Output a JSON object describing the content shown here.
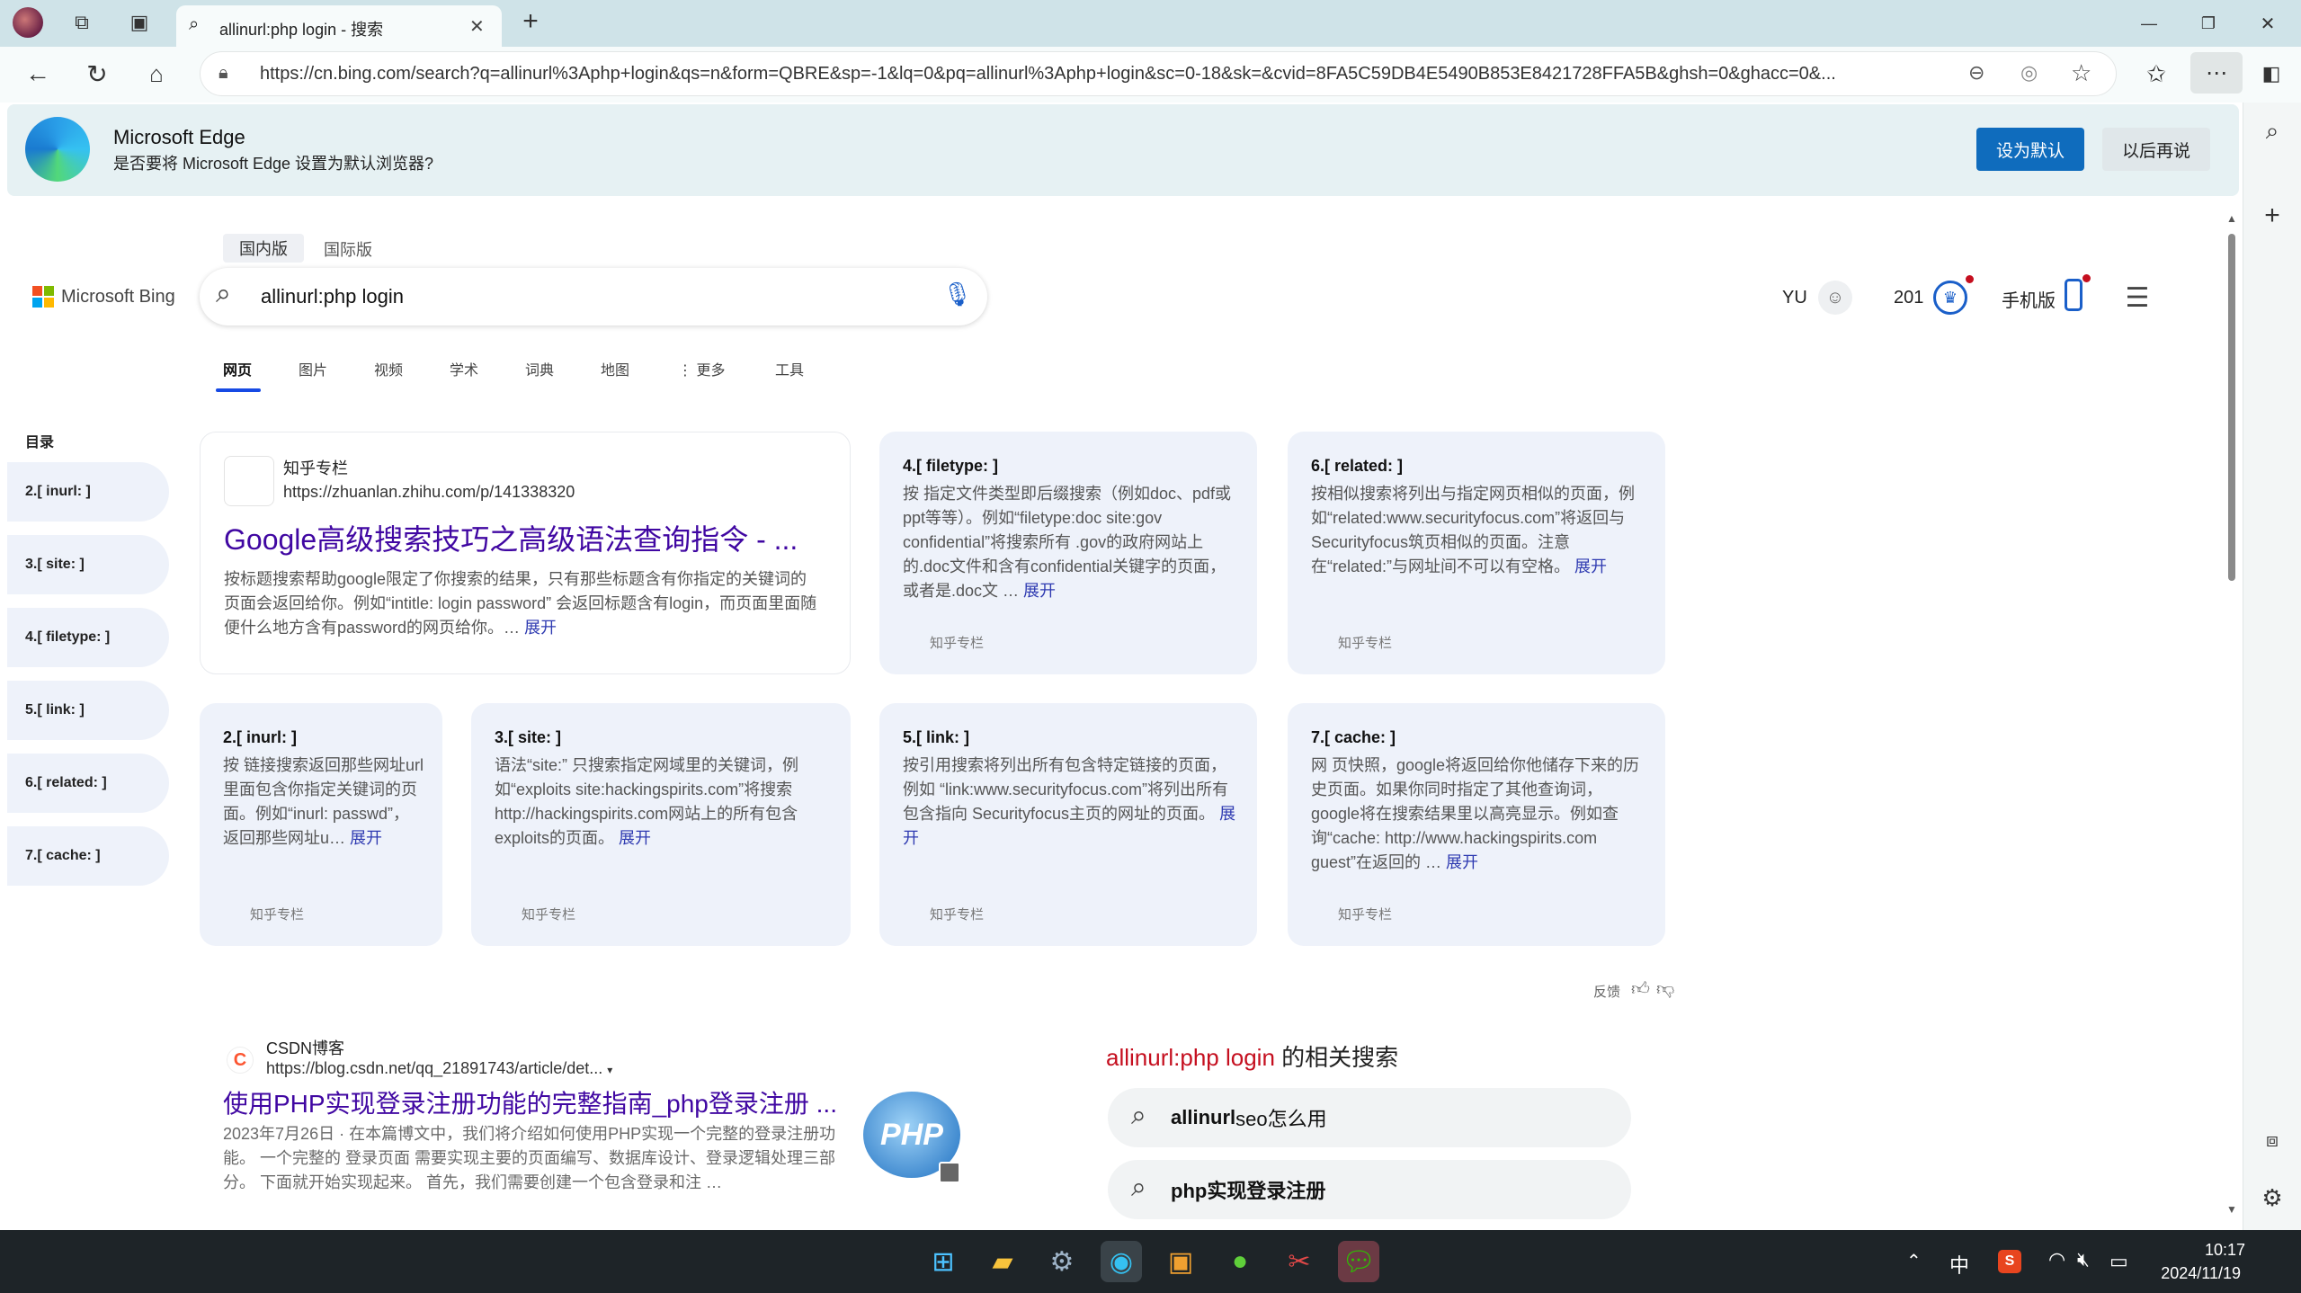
{
  "browser": {
    "tab_title": "allinurl:php login - 搜索",
    "new_tab": "+",
    "window_controls": [
      "—",
      "❐",
      "✕"
    ],
    "url": "https://cn.bing.com/search?q=allinurl%3Aphp+login&qs=n&form=QBRE&sp=-1&lq=0&pq=allinurl%3Aphp+login&sc=0-18&sk=&cvid=8FA5C59DB4E5490B853E8421728FFA5B&ghsh=0&ghacc=0&..."
  },
  "banner": {
    "title": "Microsoft Edge",
    "subtitle": "是否要将 Microsoft Edge 设置为默认浏览器?",
    "primary": "设为默认",
    "secondary": "以后再说"
  },
  "bing": {
    "logo": "Microsoft Bing",
    "region_tabs": [
      "国内版",
      "国际版"
    ],
    "query": "allinurl:php login",
    "user": "YU",
    "points": "201",
    "mobile": "手机版",
    "nav": [
      "网页",
      "图片",
      "视频",
      "学术",
      "词典",
      "地图",
      "⋮ 更多",
      "工具"
    ]
  },
  "toc": {
    "title": "目录",
    "items": [
      "2.[ inurl: ]",
      "3.[ site: ]",
      "4.[ filetype: ]",
      "5.[ link: ]",
      "6.[ related: ]",
      "7.[ cache: ]"
    ]
  },
  "main_card": {
    "site": "知乎专栏",
    "url": "https://zhuanlan.zhihu.com/p/141338320",
    "title": "Google高级搜索技巧之高级语法查询指令 - ...",
    "snippet": "按标题搜索帮助google限定了你搜索的结果，只有那些标题含有你指定的关键词的页面会返回给你。例如“intitle: login password” 会返回标题含有login，而页面里面随便什么地方含有password的网页给你。…",
    "more": "展开"
  },
  "cards": [
    {
      "title": "4.[ filetype: ]",
      "body": "按 指定文件类型即后缀搜索（例如doc、pdf或ppt等等）。例如“filetype:doc site:gov confidential”将搜索所有 .gov的政府网站上的.doc文件和含有confidential关键字的页面，或者是.doc文 …",
      "more": "展开",
      "src": "知乎专栏"
    },
    {
      "title": "6.[ related: ]",
      "body": "按相似搜索将列出与指定网页相似的页面，例如“related:www.securityfocus.com”将返回与Securityfocus筑页相似的页面。注意在“related:”与网址间不可以有空格。",
      "more": "展开",
      "src": "知乎专栏"
    },
    {
      "title": "2.[ inurl: ]",
      "body": "按 链接搜索返回那些网址url里面包含你指定关键词的页面。例如“inurl: passwd”，返回那些网址u…",
      "more": "展开",
      "src": "知乎专栏"
    },
    {
      "title": "3.[ site: ]",
      "body": "语法“site:” 只搜索指定网域里的关键词，例如“exploits site:hackingspirits.com”将搜索http://hackingspirits.com网站上的所有包含exploits的页面。",
      "more": "展开",
      "src": "知乎专栏"
    },
    {
      "title": "5.[ link: ]",
      "body": "按引用搜索将列出所有包含特定链接的页面，例如 “link:www.securityfocus.com”将列出所有包含指向 Securityfocus主页的网址的页面。",
      "more": "展开",
      "src": "知乎专栏"
    },
    {
      "title": "7.[ cache: ]",
      "body": "网 页快照，google将返回给你他储存下来的历史页面。如果你同时指定了其他查询词，google将在搜索结果里以高亮显示。例如查询“cache: http://www.hackingspirits.com guest”在返回的 …",
      "more": "展开",
      "src": "知乎专栏"
    }
  ],
  "feedback": "反馈",
  "result2": {
    "site": "CSDN博客",
    "url": "https://blog.csdn.net/qq_21891743/article/det...",
    "title": "使用PHP实现登录注册功能的完整指南_php登录注册 ...",
    "date": "2023年7月26日 ·",
    "snippet": "在本篇博文中，我们将介绍如何使用PHP实现一个完整的登录注册功能。 一个完整的 登录页面 需要实现主要的页面编写、数据库设计、登录逻辑处理三部分。 下面就开始实现起来。 首先，我们需要创建一个包含登录和注 …",
    "thumb": "PHP"
  },
  "related": {
    "query": "allinurl:php login",
    "suffix": "的相关搜索",
    "items": [
      {
        "bold": "allinurl",
        "rest": " seo怎么用"
      },
      {
        "bold": "php实现登录注册",
        "rest": ""
      }
    ]
  },
  "tray": {
    "ime": "中",
    "time": "10:17",
    "date": "2024/11/19"
  },
  "colors": {
    "accent": "#0f6cbd",
    "link": "#4007a2",
    "titlebar": "#cfe3e8"
  }
}
